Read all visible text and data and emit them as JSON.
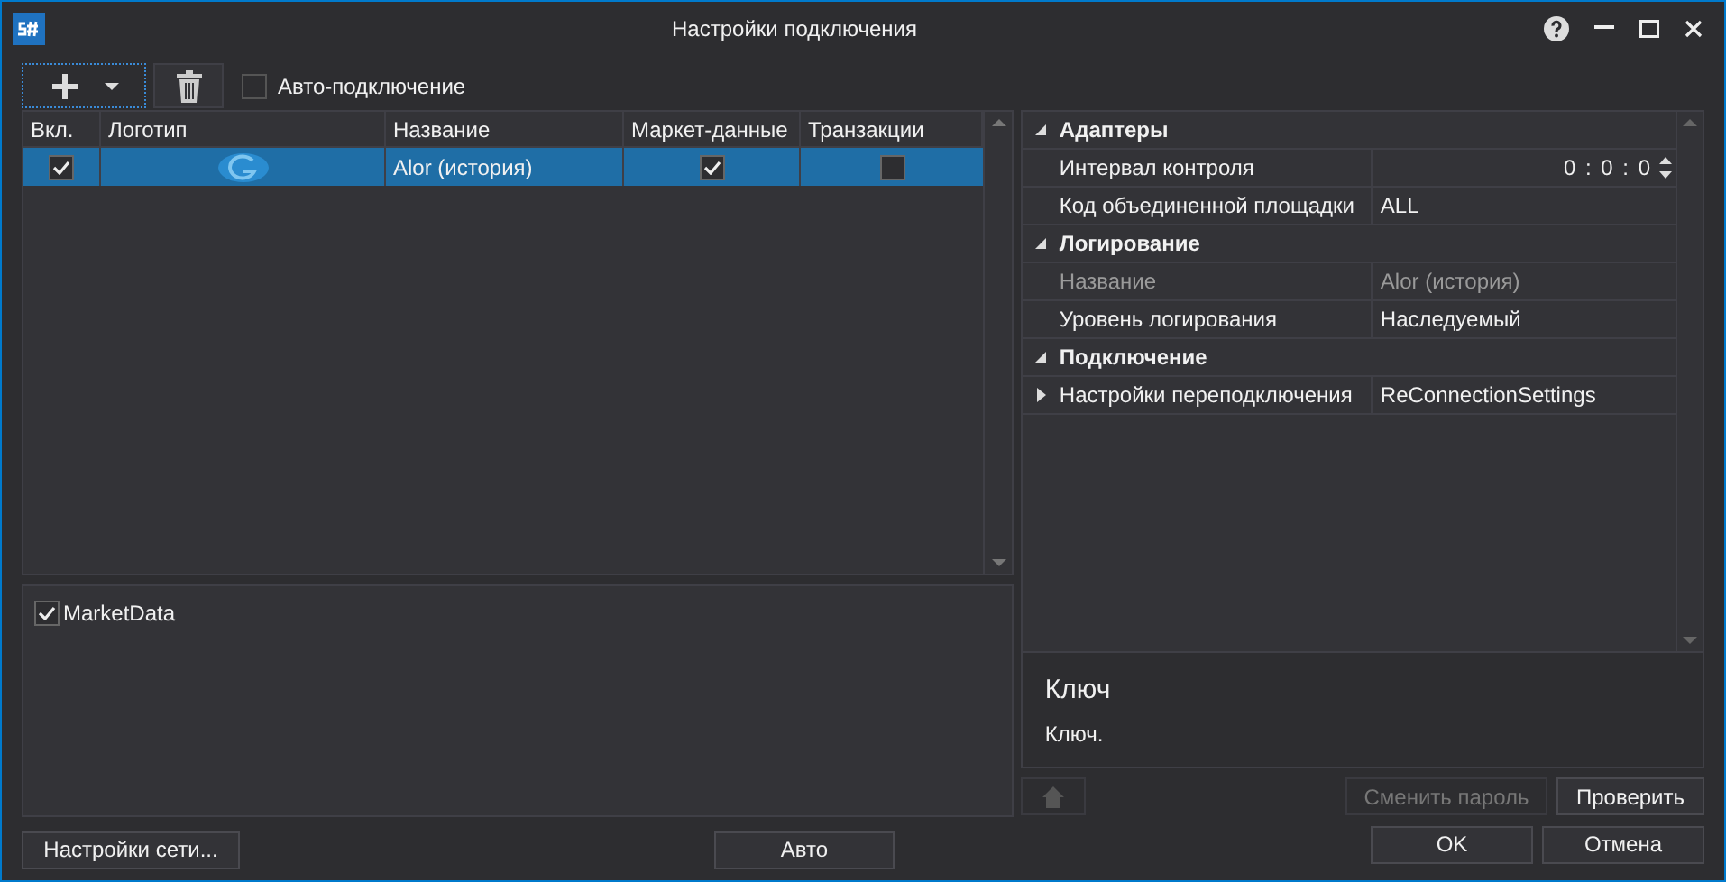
{
  "window": {
    "title": "Настройки подключения"
  },
  "toolbar": {
    "auto_connect": {
      "label": "Авто-подключение",
      "checked": false
    }
  },
  "connections": {
    "columns": [
      "Вкл.",
      "Логотип",
      "Название",
      "Маркет-данные",
      "Транзакции"
    ],
    "rows": [
      {
        "enabled": true,
        "name": "Alor (история)",
        "market_data": true,
        "transactions": false,
        "selected": true
      }
    ]
  },
  "message_types": [
    {
      "label": "MarketData",
      "checked": true
    }
  ],
  "properties": [
    {
      "name": "Адаптеры",
      "expanded": true,
      "items": [
        {
          "kind": "timespan",
          "name": "Интервал контроля",
          "value": "0 : 0 : 0",
          "readonly": false
        },
        {
          "kind": "text",
          "name": "Код объединенной площадки",
          "value": "ALL",
          "readonly": false
        }
      ]
    },
    {
      "name": "Логирование",
      "expanded": true,
      "items": [
        {
          "kind": "text",
          "name": "Название",
          "value": "Alor (история)",
          "readonly": true
        },
        {
          "kind": "text",
          "name": "Уровень логирования",
          "value": "Наследуемый",
          "readonly": false
        }
      ]
    },
    {
      "name": "Подключение",
      "expanded": true,
      "items": [
        {
          "kind": "nested",
          "name": "Настройки переподключения",
          "value": "ReConnectionSettings",
          "readonly": false,
          "expanded": false
        }
      ]
    }
  ],
  "description": {
    "title": "Ключ",
    "text": "Ключ."
  },
  "property_buttons": [
    {
      "label": "Сменить пароль",
      "disabled": true
    },
    {
      "label": "Проверить",
      "disabled": false
    }
  ],
  "footer_buttons": {
    "left": "Настройки сети...",
    "center": "Авто",
    "ok": "OK",
    "cancel": "Отмена"
  }
}
